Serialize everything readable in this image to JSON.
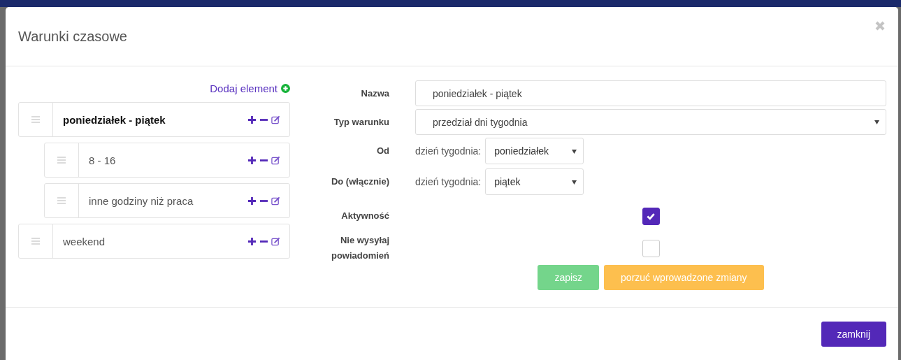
{
  "dialog": {
    "title": "Warunki czasowe"
  },
  "tree": {
    "add_label": "Dodaj element",
    "items": [
      {
        "label": "poniedziałek - piątek",
        "selected": true,
        "children": [
          {
            "label": "8 - 16",
            "selected": false
          },
          {
            "label": "inne godziny niż praca",
            "selected": false
          }
        ]
      },
      {
        "label": "weekend",
        "selected": false
      }
    ]
  },
  "form": {
    "fields": [
      {
        "kind": "text",
        "label": "Nazwa",
        "value": "poniedziałek - piątek"
      },
      {
        "kind": "select",
        "label": "Typ warunku",
        "value": "przedział dni tygodnia"
      },
      {
        "kind": "prefixed-select",
        "label": "Od",
        "prefix": "dzień tygodnia:",
        "value": "poniedziałek"
      },
      {
        "kind": "prefixed-select",
        "label": "Do (włącznie)",
        "prefix": "dzień tygodnia:",
        "value": "piątek"
      },
      {
        "kind": "checkbox",
        "label": "Aktywność",
        "checked": true
      },
      {
        "kind": "checkbox",
        "label": "Nie wysyłaj powiadomień",
        "checked": false
      }
    ],
    "buttons": [
      {
        "label": "zapisz",
        "kind": "success"
      },
      {
        "label": "porzuć wprowadzone zmiany",
        "kind": "warning"
      }
    ]
  },
  "footer": {
    "buttons": [
      {
        "label": "zamknij",
        "kind": "primary"
      }
    ]
  }
}
